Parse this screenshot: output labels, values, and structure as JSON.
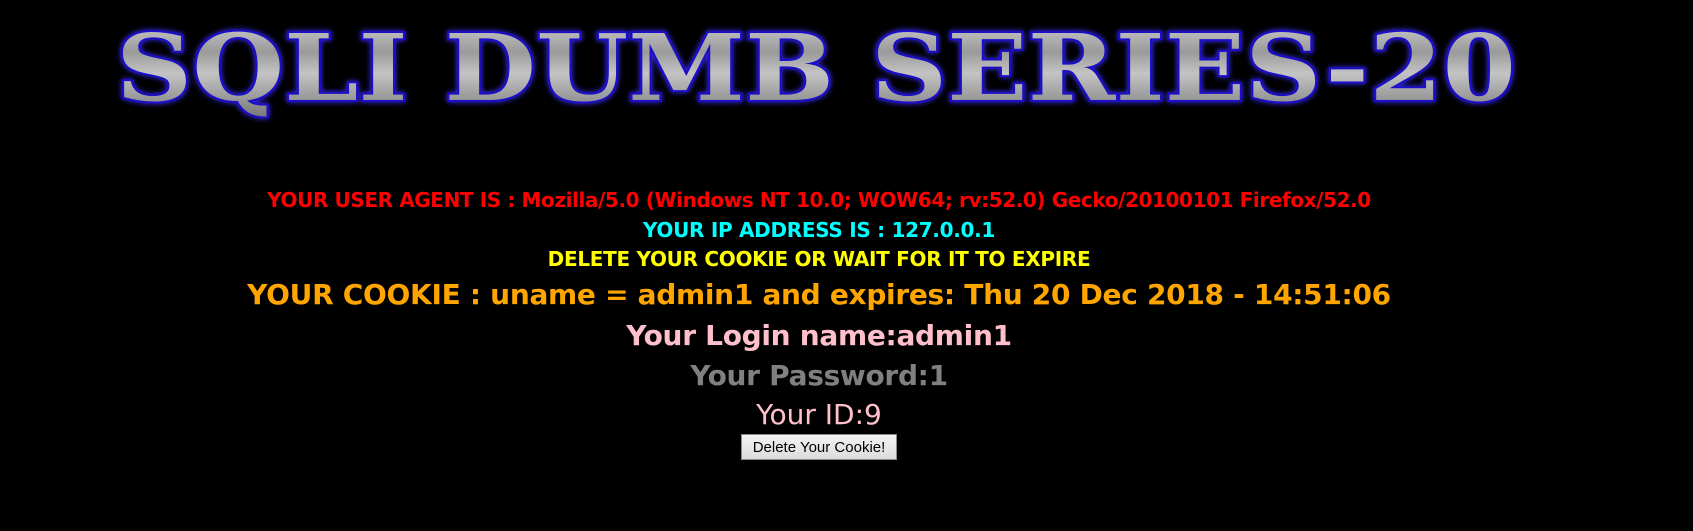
{
  "banner": {
    "title": "SQLI DUMB SERIES-20"
  },
  "info": {
    "user_agent": "YOUR USER AGENT IS : Mozilla/5.0 (Windows NT 10.0; WOW64; rv:52.0) Gecko/20100101 Firefox/52.0",
    "ip_address": "YOUR IP ADDRESS IS : 127.0.0.1",
    "delete_notice": "DELETE YOUR COOKIE OR WAIT FOR IT TO EXPIRE",
    "cookie": "YOUR COOKIE : uname = admin1 and expires: Thu 20 Dec 2018 - 14:51:06",
    "login_name": "Your Login name:admin1",
    "password": "Your Password:1",
    "user_id": "Your ID:9"
  },
  "form": {
    "delete_button_label": "Delete Your Cookie!"
  },
  "colors": {
    "background": "#000000",
    "user_agent": "#ff0000",
    "ip_address": "#00ffff",
    "delete_notice": "#ffff00",
    "cookie": "#ffa500",
    "login_name": "#ffc0cb",
    "password": "#808080",
    "user_id": "#ffc0cb"
  }
}
